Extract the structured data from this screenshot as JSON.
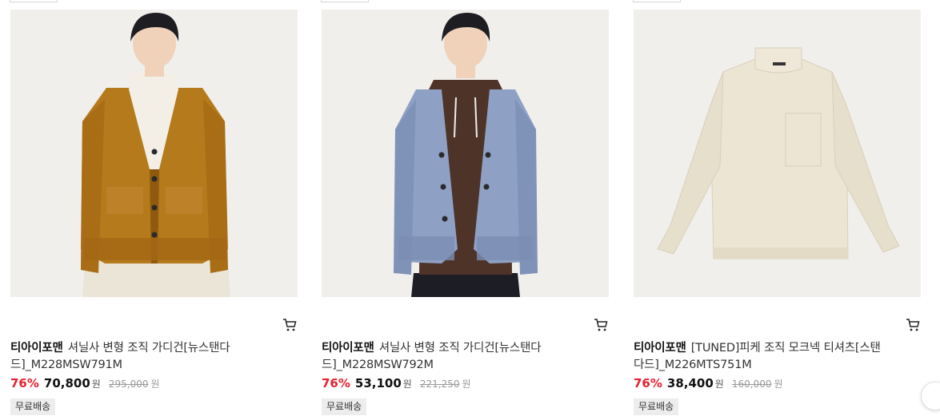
{
  "products": [
    {
      "brand": "티아이포맨",
      "name": "셔닐사 변형 조직 가디건[뉴스탠다드]_M228MSW791M",
      "discount": "76%",
      "price": "70,800",
      "currency": "원",
      "original_price": "295,000",
      "original_currency": "원",
      "badge": "무료배송",
      "image": "model-mustard-cardigan",
      "image_colors": {
        "garment": "#b47a1c",
        "inner": "#f4efe6",
        "pants": "#ebe5d7"
      }
    },
    {
      "brand": "티아이포맨",
      "name": "셔닐사 변형 조직 가디건[뉴스탠다드]_M228MSW792M",
      "discount": "76%",
      "price": "53,100",
      "currency": "원",
      "original_price": "221,250",
      "original_currency": "원",
      "badge": "무료배송",
      "image": "model-blue-cardigan",
      "image_colors": {
        "garment": "#8ea0c4",
        "inner": "#4e3428",
        "pants": "#1d1d26"
      }
    },
    {
      "brand": "티아이포맨",
      "name": "[TUNED]피케 조직 모크넥 티셔츠[스탠다드]_M226MTS751M",
      "discount": "76%",
      "price": "38,400",
      "currency": "원",
      "original_price": "160,000",
      "original_currency": "원",
      "badge": "무료배송",
      "image": "cream-mockneck-tshirt",
      "image_colors": {
        "garment": "#ece5d4"
      }
    }
  ],
  "colors": {
    "discount": "#e5202f",
    "badge_bg": "#ededed"
  },
  "icons": {
    "cart": "cart-icon",
    "next": "chevron-right-icon"
  }
}
